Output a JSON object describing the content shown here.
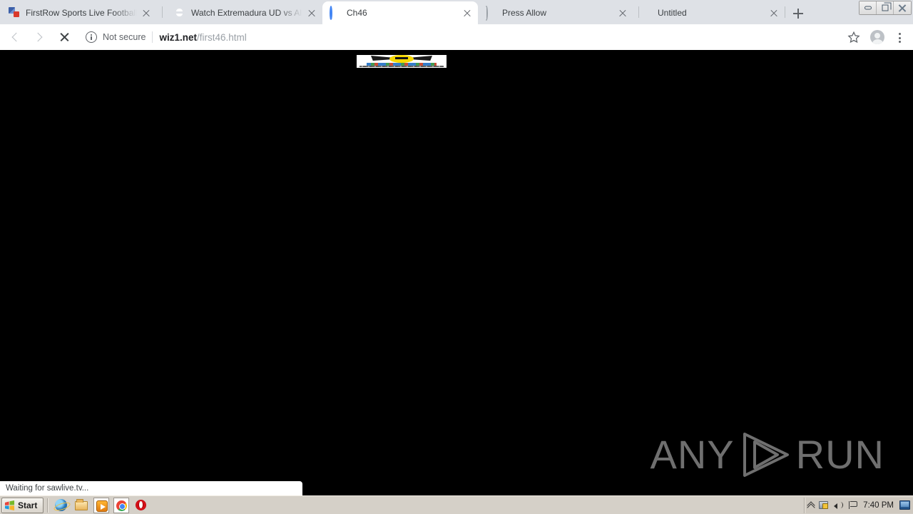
{
  "window": {
    "controls": [
      {
        "name": "minimize",
        "label": "Minimize"
      },
      {
        "name": "restore",
        "label": "Restore"
      },
      {
        "name": "close",
        "label": "Close"
      }
    ]
  },
  "tabs": [
    {
      "title": "FirstRow Sports Live Football St",
      "favicon": "firstrow-icon",
      "active": false,
      "loading": false
    },
    {
      "title": "Watch Extremadura UD vs Alme",
      "favicon": "globe-icon",
      "active": false,
      "loading": false
    },
    {
      "title": "Ch46",
      "favicon": "spinner-icon",
      "active": true,
      "loading": true
    },
    {
      "title": "Press Allow",
      "favicon": "spinner-icon",
      "active": false,
      "loading": true
    },
    {
      "title": "Untitled",
      "favicon": "none",
      "active": false,
      "loading": false
    }
  ],
  "newtab": {
    "label": "New Tab"
  },
  "toolbar": {
    "back_label": "Back",
    "forward_label": "Forward",
    "stop_label": "Stop loading this page",
    "security_text": "Not secure",
    "url_host": "wiz1.net",
    "url_path": "/first46.html",
    "bookmark_label": "Bookmark this tab",
    "profile_label": "Profile",
    "menu_label": "Customize and control Google Chrome"
  },
  "page": {
    "banner_alt": "advertisement banner",
    "watermark_left": "ANY",
    "watermark_right": "RUN"
  },
  "status": {
    "text": "Waiting for sawlive.tv..."
  },
  "taskbar": {
    "start_label": "Start",
    "quicklaunch": [
      {
        "name": "internet-explorer-icon",
        "label": "Internet Explorer"
      },
      {
        "name": "folder-icon",
        "label": "File Explorer"
      },
      {
        "name": "media-player-icon",
        "label": "Windows Media Player"
      },
      {
        "name": "chrome-icon",
        "label": "Google Chrome"
      },
      {
        "name": "opera-icon",
        "label": "Opera"
      }
    ],
    "tray": [
      {
        "name": "show-hidden-icons-icon",
        "label": "Show hidden icons"
      },
      {
        "name": "network-icon",
        "label": "Network"
      },
      {
        "name": "volume-icon",
        "label": "Volume"
      },
      {
        "name": "flag-icon",
        "label": "Action Center"
      }
    ],
    "clock": "7:40 PM",
    "show_desktop_label": "Show Desktop"
  },
  "colors": {
    "tabstrip": "#dee1e6",
    "toolbar": "#ffffff",
    "page_background": "#000000",
    "taskbar": "#d5d0c8",
    "spinner_accent": "#4285f4",
    "watermark": "#6f6f6f"
  }
}
